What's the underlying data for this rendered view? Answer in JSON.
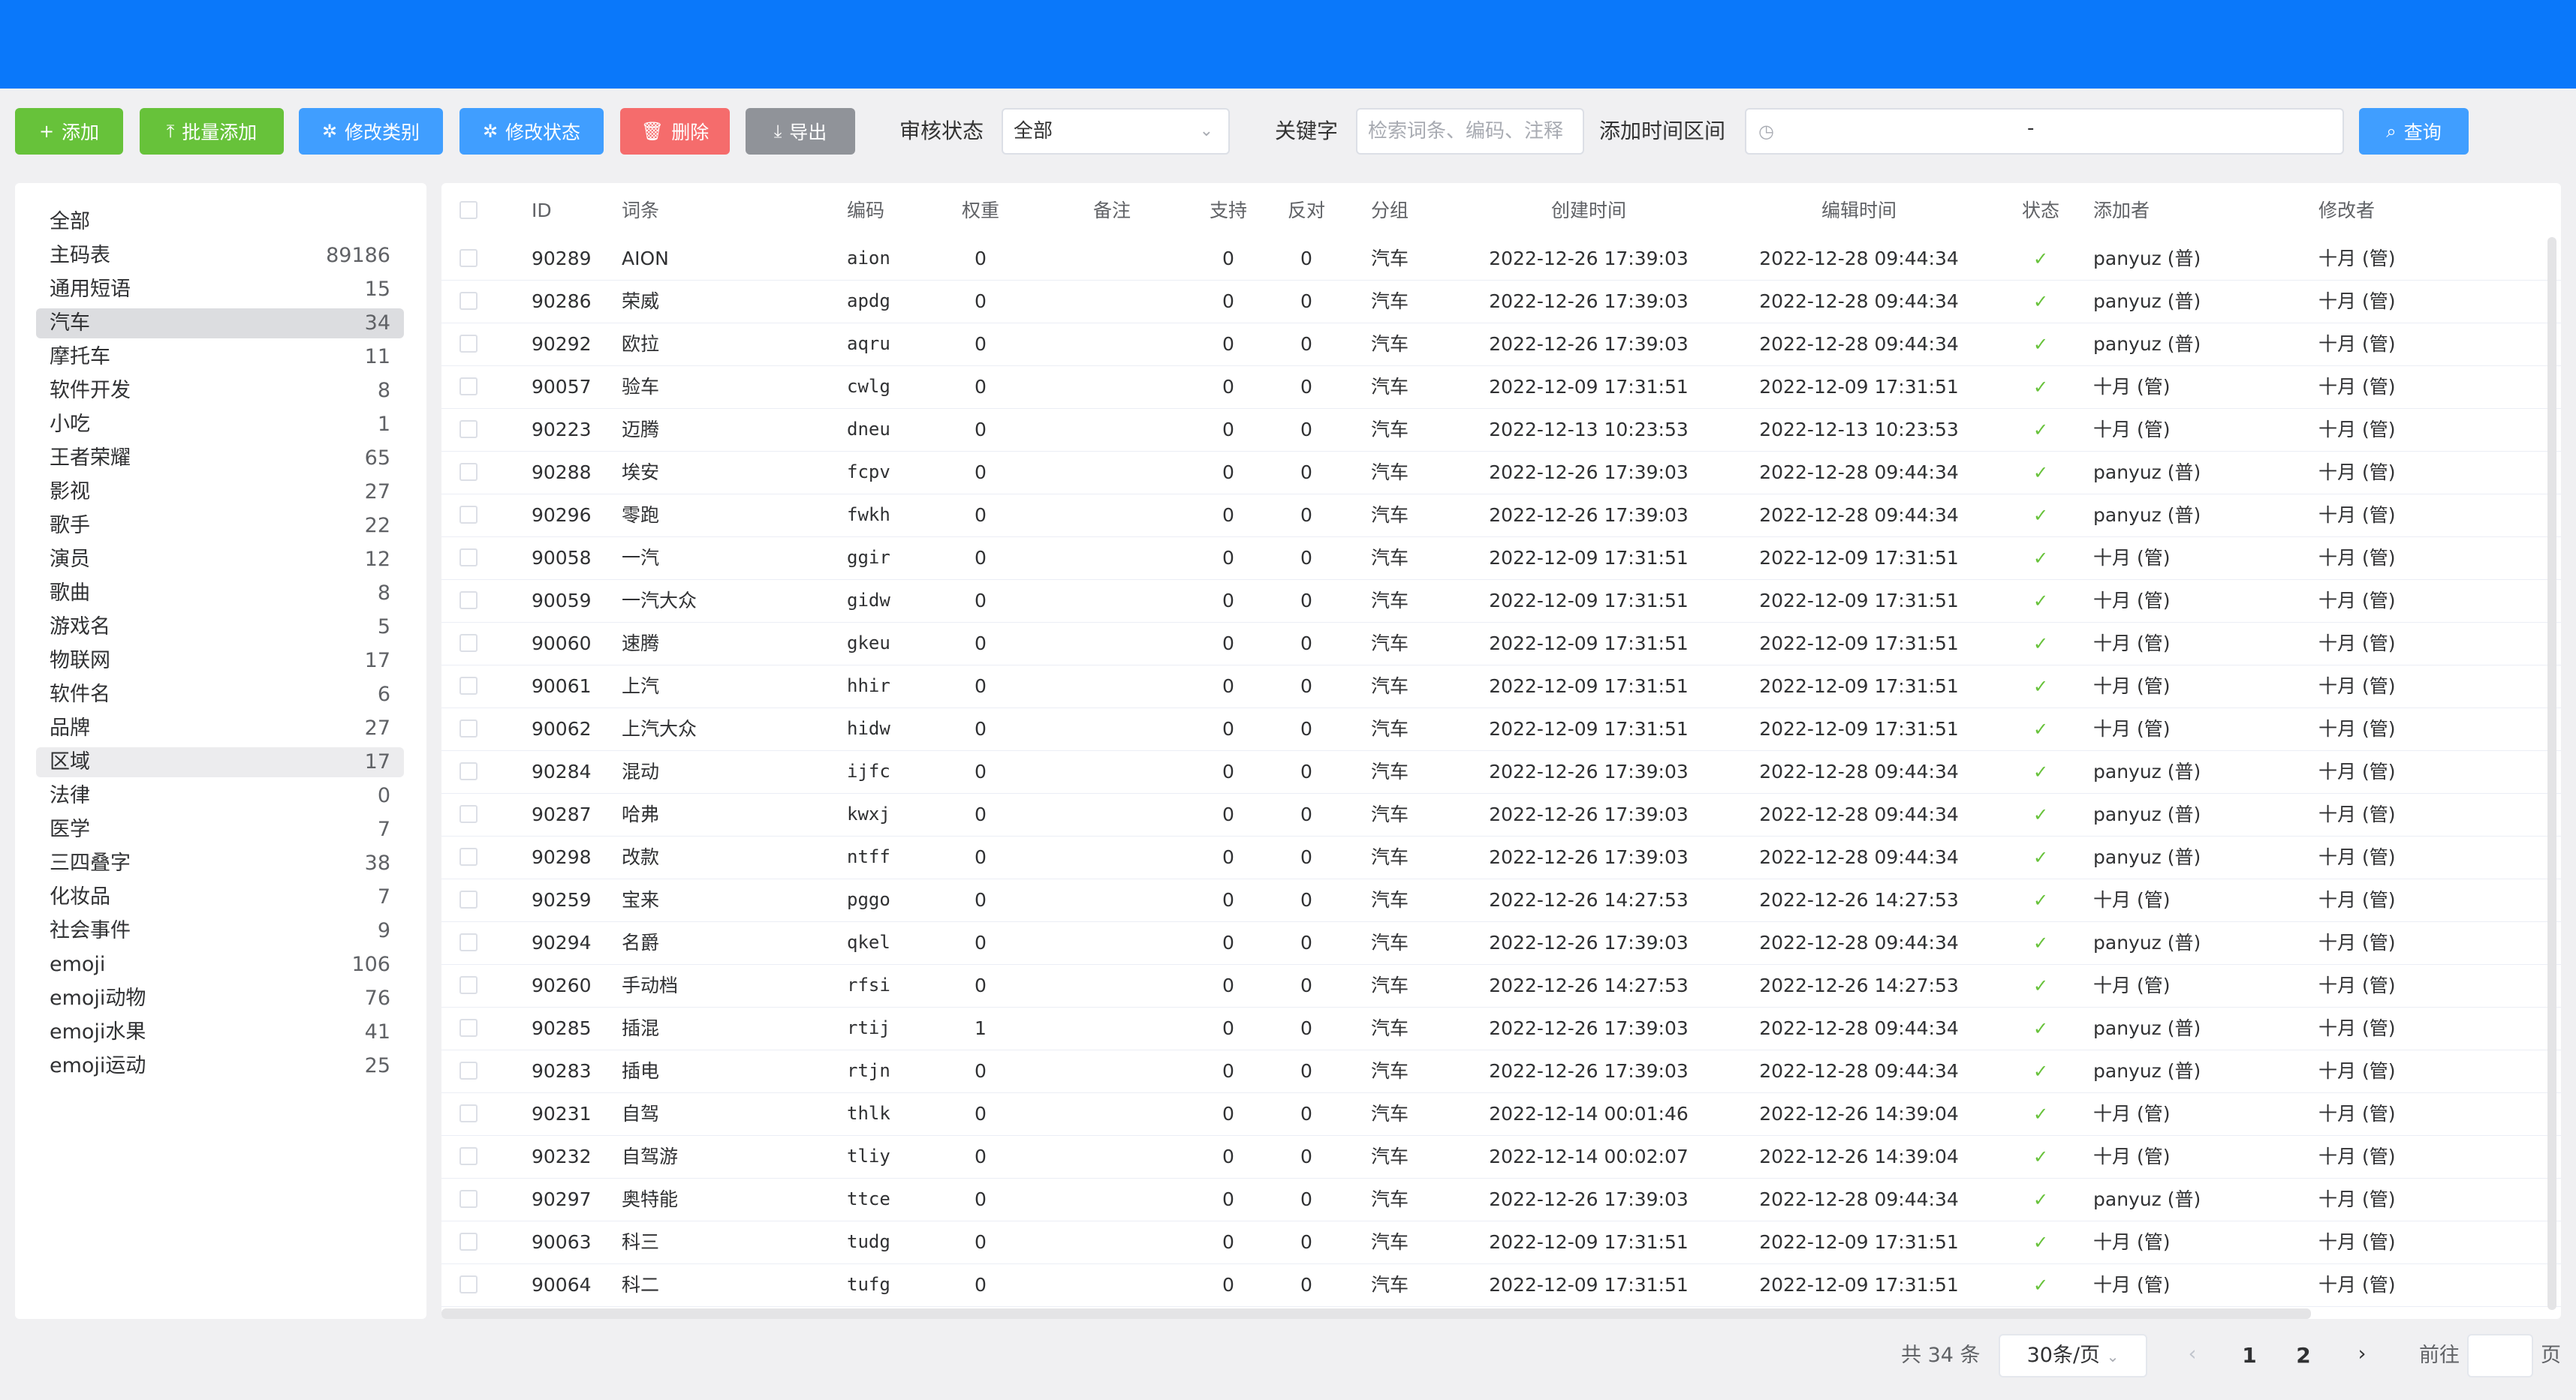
{
  "toolbar": {
    "add": "添加",
    "batch_add": "批量添加",
    "modify_category": "修改类别",
    "modify_status": "修改状态",
    "delete": "删除",
    "export": "导出",
    "review_status_label": "审核状态",
    "review_status_value": "全部",
    "keyword_label": "关键字",
    "keyword_placeholder": "检索词条、编码、注释",
    "time_range_label": "添加时间区间",
    "time_range_separator": "-",
    "query": "查询"
  },
  "colors": {
    "topbar": "#0a78fa",
    "add": "#67c23a",
    "primary": "#409eff",
    "danger": "#f56c6c",
    "info": "#909399"
  },
  "categories": [
    {
      "name": "全部",
      "count": ""
    },
    {
      "name": "主码表",
      "count": "89186"
    },
    {
      "name": "通用短语",
      "count": "15"
    },
    {
      "name": "汽车",
      "count": "34"
    },
    {
      "name": "摩托车",
      "count": "11"
    },
    {
      "name": "软件开发",
      "count": "8"
    },
    {
      "name": "小吃",
      "count": "1"
    },
    {
      "name": "王者荣耀",
      "count": "65"
    },
    {
      "name": "影视",
      "count": "27"
    },
    {
      "name": "歌手",
      "count": "22"
    },
    {
      "name": "演员",
      "count": "12"
    },
    {
      "name": "歌曲",
      "count": "8"
    },
    {
      "name": "游戏名",
      "count": "5"
    },
    {
      "name": "物联网",
      "count": "17"
    },
    {
      "name": "软件名",
      "count": "6"
    },
    {
      "name": "品牌",
      "count": "27"
    },
    {
      "name": "区域",
      "count": "17"
    },
    {
      "name": "法律",
      "count": "0"
    },
    {
      "name": "医学",
      "count": "7"
    },
    {
      "name": "三四叠字",
      "count": "38"
    },
    {
      "name": "化妆品",
      "count": "7"
    },
    {
      "name": "社会事件",
      "count": "9"
    },
    {
      "name": "emoji",
      "count": "106"
    },
    {
      "name": "emoji动物",
      "count": "76"
    },
    {
      "name": "emoji水果",
      "count": "41"
    },
    {
      "name": "emoji运动",
      "count": "25"
    }
  ],
  "table": {
    "headers": {
      "id": "ID",
      "term": "词条",
      "code": "编码",
      "weight": "权重",
      "remark": "备注",
      "support": "支持",
      "oppose": "反对",
      "group": "分组",
      "created": "创建时间",
      "edited": "编辑时间",
      "status": "状态",
      "adder": "添加者",
      "modifier": "修改者"
    },
    "rows": [
      {
        "id": "90289",
        "term": "AION",
        "code": "aion",
        "weight": "0",
        "support": "0",
        "oppose": "0",
        "group": "汽车",
        "created": "2022-12-26 17:39:03",
        "edited": "2022-12-28 09:44:34",
        "adder": "panyuz (普)",
        "modifier": "十月 (管)"
      },
      {
        "id": "90286",
        "term": "荣威",
        "code": "apdg",
        "weight": "0",
        "support": "0",
        "oppose": "0",
        "group": "汽车",
        "created": "2022-12-26 17:39:03",
        "edited": "2022-12-28 09:44:34",
        "adder": "panyuz (普)",
        "modifier": "十月 (管)"
      },
      {
        "id": "90292",
        "term": "欧拉",
        "code": "aqru",
        "weight": "0",
        "support": "0",
        "oppose": "0",
        "group": "汽车",
        "created": "2022-12-26 17:39:03",
        "edited": "2022-12-28 09:44:34",
        "adder": "panyuz (普)",
        "modifier": "十月 (管)"
      },
      {
        "id": "90057",
        "term": "验车",
        "code": "cwlg",
        "weight": "0",
        "support": "0",
        "oppose": "0",
        "group": "汽车",
        "created": "2022-12-09 17:31:51",
        "edited": "2022-12-09 17:31:51",
        "adder": "十月 (管)",
        "modifier": "十月 (管)"
      },
      {
        "id": "90223",
        "term": "迈腾",
        "code": "dneu",
        "weight": "0",
        "support": "0",
        "oppose": "0",
        "group": "汽车",
        "created": "2022-12-13 10:23:53",
        "edited": "2022-12-13 10:23:53",
        "adder": "十月 (管)",
        "modifier": "十月 (管)"
      },
      {
        "id": "90288",
        "term": "埃安",
        "code": "fcpv",
        "weight": "0",
        "support": "0",
        "oppose": "0",
        "group": "汽车",
        "created": "2022-12-26 17:39:03",
        "edited": "2022-12-28 09:44:34",
        "adder": "panyuz (普)",
        "modifier": "十月 (管)"
      },
      {
        "id": "90296",
        "term": "零跑",
        "code": "fwkh",
        "weight": "0",
        "support": "0",
        "oppose": "0",
        "group": "汽车",
        "created": "2022-12-26 17:39:03",
        "edited": "2022-12-28 09:44:34",
        "adder": "panyuz (普)",
        "modifier": "十月 (管)"
      },
      {
        "id": "90058",
        "term": "一汽",
        "code": "ggir",
        "weight": "0",
        "support": "0",
        "oppose": "0",
        "group": "汽车",
        "created": "2022-12-09 17:31:51",
        "edited": "2022-12-09 17:31:51",
        "adder": "十月 (管)",
        "modifier": "十月 (管)"
      },
      {
        "id": "90059",
        "term": "一汽大众",
        "code": "gidw",
        "weight": "0",
        "support": "0",
        "oppose": "0",
        "group": "汽车",
        "created": "2022-12-09 17:31:51",
        "edited": "2022-12-09 17:31:51",
        "adder": "十月 (管)",
        "modifier": "十月 (管)"
      },
      {
        "id": "90060",
        "term": "速腾",
        "code": "gkeu",
        "weight": "0",
        "support": "0",
        "oppose": "0",
        "group": "汽车",
        "created": "2022-12-09 17:31:51",
        "edited": "2022-12-09 17:31:51",
        "adder": "十月 (管)",
        "modifier": "十月 (管)"
      },
      {
        "id": "90061",
        "term": "上汽",
        "code": "hhir",
        "weight": "0",
        "support": "0",
        "oppose": "0",
        "group": "汽车",
        "created": "2022-12-09 17:31:51",
        "edited": "2022-12-09 17:31:51",
        "adder": "十月 (管)",
        "modifier": "十月 (管)"
      },
      {
        "id": "90062",
        "term": "上汽大众",
        "code": "hidw",
        "weight": "0",
        "support": "0",
        "oppose": "0",
        "group": "汽车",
        "created": "2022-12-09 17:31:51",
        "edited": "2022-12-09 17:31:51",
        "adder": "十月 (管)",
        "modifier": "十月 (管)"
      },
      {
        "id": "90284",
        "term": "混动",
        "code": "ijfc",
        "weight": "0",
        "support": "0",
        "oppose": "0",
        "group": "汽车",
        "created": "2022-12-26 17:39:03",
        "edited": "2022-12-28 09:44:34",
        "adder": "panyuz (普)",
        "modifier": "十月 (管)"
      },
      {
        "id": "90287",
        "term": "哈弗",
        "code": "kwxj",
        "weight": "0",
        "support": "0",
        "oppose": "0",
        "group": "汽车",
        "created": "2022-12-26 17:39:03",
        "edited": "2022-12-28 09:44:34",
        "adder": "panyuz (普)",
        "modifier": "十月 (管)"
      },
      {
        "id": "90298",
        "term": "改款",
        "code": "ntff",
        "weight": "0",
        "support": "0",
        "oppose": "0",
        "group": "汽车",
        "created": "2022-12-26 17:39:03",
        "edited": "2022-12-28 09:44:34",
        "adder": "panyuz (普)",
        "modifier": "十月 (管)"
      },
      {
        "id": "90259",
        "term": "宝来",
        "code": "pggo",
        "weight": "0",
        "support": "0",
        "oppose": "0",
        "group": "汽车",
        "created": "2022-12-26 14:27:53",
        "edited": "2022-12-26 14:27:53",
        "adder": "十月 (管)",
        "modifier": "十月 (管)"
      },
      {
        "id": "90294",
        "term": "名爵",
        "code": "qkel",
        "weight": "0",
        "support": "0",
        "oppose": "0",
        "group": "汽车",
        "created": "2022-12-26 17:39:03",
        "edited": "2022-12-28 09:44:34",
        "adder": "panyuz (普)",
        "modifier": "十月 (管)"
      },
      {
        "id": "90260",
        "term": "手动档",
        "code": "rfsi",
        "weight": "0",
        "support": "0",
        "oppose": "0",
        "group": "汽车",
        "created": "2022-12-26 14:27:53",
        "edited": "2022-12-26 14:27:53",
        "adder": "十月 (管)",
        "modifier": "十月 (管)"
      },
      {
        "id": "90285",
        "term": "插混",
        "code": "rtij",
        "weight": "1",
        "support": "0",
        "oppose": "0",
        "group": "汽车",
        "created": "2022-12-26 17:39:03",
        "edited": "2022-12-28 09:44:34",
        "adder": "panyuz (普)",
        "modifier": "十月 (管)"
      },
      {
        "id": "90283",
        "term": "插电",
        "code": "rtjn",
        "weight": "0",
        "support": "0",
        "oppose": "0",
        "group": "汽车",
        "created": "2022-12-26 17:39:03",
        "edited": "2022-12-28 09:44:34",
        "adder": "panyuz (普)",
        "modifier": "十月 (管)"
      },
      {
        "id": "90231",
        "term": "自驾",
        "code": "thlk",
        "weight": "0",
        "support": "0",
        "oppose": "0",
        "group": "汽车",
        "created": "2022-12-14 00:01:46",
        "edited": "2022-12-26 14:39:04",
        "adder": "十月 (管)",
        "modifier": "十月 (管)"
      },
      {
        "id": "90232",
        "term": "自驾游",
        "code": "tliy",
        "weight": "0",
        "support": "0",
        "oppose": "0",
        "group": "汽车",
        "created": "2022-12-14 00:02:07",
        "edited": "2022-12-26 14:39:04",
        "adder": "十月 (管)",
        "modifier": "十月 (管)"
      },
      {
        "id": "90297",
        "term": "奥特能",
        "code": "ttce",
        "weight": "0",
        "support": "0",
        "oppose": "0",
        "group": "汽车",
        "created": "2022-12-26 17:39:03",
        "edited": "2022-12-28 09:44:34",
        "adder": "panyuz (普)",
        "modifier": "十月 (管)"
      },
      {
        "id": "90063",
        "term": "科三",
        "code": "tudg",
        "weight": "0",
        "support": "0",
        "oppose": "0",
        "group": "汽车",
        "created": "2022-12-09 17:31:51",
        "edited": "2022-12-09 17:31:51",
        "adder": "十月 (管)",
        "modifier": "十月 (管)"
      },
      {
        "id": "90064",
        "term": "科二",
        "code": "tufg",
        "weight": "0",
        "support": "0",
        "oppose": "0",
        "group": "汽车",
        "created": "2022-12-09 17:31:51",
        "edited": "2022-12-09 17:31:51",
        "adder": "十月 (管)",
        "modifier": "十月 (管)"
      }
    ]
  },
  "pagination": {
    "total": "共 34 条",
    "page_size": "30条/页",
    "pages": [
      "1",
      "2"
    ],
    "goto_label": "前往",
    "page_suffix": "页"
  }
}
